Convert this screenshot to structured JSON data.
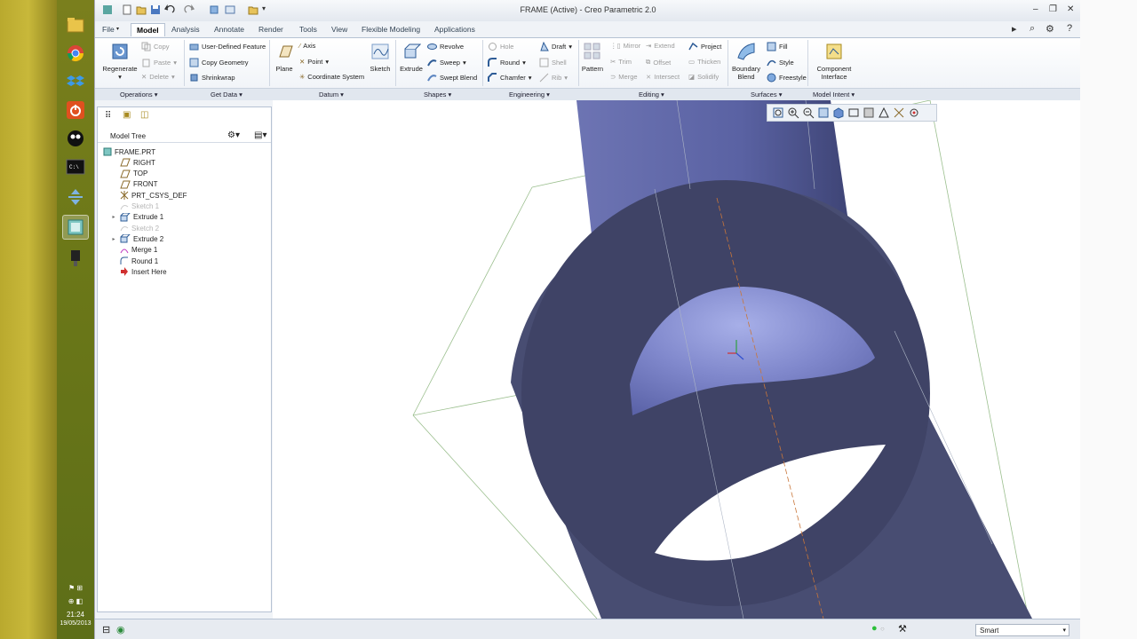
{
  "window": {
    "title": "FRAME (Active) - Creo Parametric 2.0"
  },
  "os": {
    "clock_time": "21:24",
    "clock_date": "19/05/2013"
  },
  "tabs": [
    "File",
    "Model",
    "Analysis",
    "Annotate",
    "Render",
    "Tools",
    "View",
    "Flexible Modeling",
    "Applications"
  ],
  "ribbon": {
    "operations": {
      "regenerate": "Regenerate",
      "copy": "Copy",
      "paste": "Paste",
      "delete": "Delete"
    },
    "get_data": {
      "udf": "User-Defined Feature",
      "copy_geometry": "Copy Geometry",
      "shrinkwrap": "Shrinkwrap"
    },
    "datum": {
      "plane": "Plane",
      "axis": "Axis",
      "point": "Point",
      "csys": "Coordinate System",
      "sketch": "Sketch"
    },
    "shapes": {
      "extrude": "Extrude",
      "revolve": "Revolve",
      "sweep": "Sweep",
      "swept_blend": "Swept Blend"
    },
    "engineering": {
      "hole": "Hole",
      "round": "Round",
      "chamfer": "Chamfer",
      "draft": "Draft",
      "shell": "Shell",
      "rib": "Rib"
    },
    "editing": {
      "pattern": "Pattern",
      "mirror": "Mirror",
      "trim": "Trim",
      "merge": "Merge",
      "extend": "Extend",
      "offset": "Offset",
      "intersect": "Intersect",
      "project": "Project",
      "thicken": "Thicken",
      "solidify": "Solidify"
    },
    "surfaces": {
      "boundary_blend_1": "Boundary",
      "boundary_blend_2": "Blend",
      "fill": "Fill",
      "style": "Style",
      "freestyle": "Freestyle"
    },
    "model_intent": {
      "component_interface_1": "Component",
      "component_interface_2": "Interface"
    },
    "groups": [
      "Operations",
      "Get Data",
      "Datum",
      "Shapes",
      "Engineering",
      "Editing",
      "Surfaces",
      "Model Intent"
    ]
  },
  "model_tree": {
    "header": "Model Tree",
    "items": [
      {
        "label": "FRAME.PRT",
        "icon": "part-icon",
        "enabled": true
      },
      {
        "label": "RIGHT",
        "icon": "datum-plane-icon",
        "enabled": true
      },
      {
        "label": "TOP",
        "icon": "datum-plane-icon",
        "enabled": true
      },
      {
        "label": "FRONT",
        "icon": "datum-plane-icon",
        "enabled": true
      },
      {
        "label": "PRT_CSYS_DEF",
        "icon": "csys-icon",
        "enabled": true
      },
      {
        "label": "Sketch 1",
        "icon": "sketch-icon",
        "enabled": false
      },
      {
        "label": "Extrude 1",
        "icon": "extrude-icon",
        "enabled": true
      },
      {
        "label": "Sketch 2",
        "icon": "sketch-icon",
        "enabled": false
      },
      {
        "label": "Extrude 2",
        "icon": "extrude-icon",
        "enabled": true
      },
      {
        "label": "Merge 1",
        "icon": "merge-icon",
        "enabled": true
      },
      {
        "label": "Round 1",
        "icon": "round-icon",
        "enabled": true
      },
      {
        "label": "Insert Here",
        "icon": "insert-arrow-icon",
        "enabled": true
      }
    ]
  },
  "status": {
    "filter_value": "Smart"
  },
  "colors": {
    "model_surface": "#4b5178",
    "model_light": "#8d95d6",
    "accent": "#2b5797"
  }
}
